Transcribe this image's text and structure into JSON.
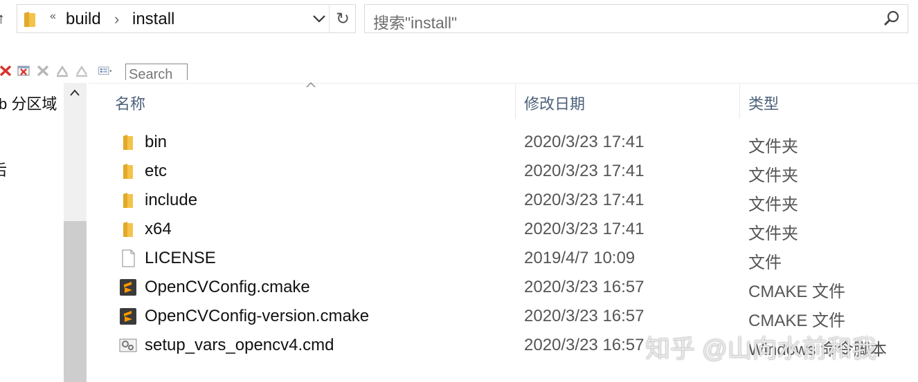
{
  "address_bar": {
    "overflow_chevron": "«",
    "crumbs": [
      "build",
      "install"
    ],
    "separator": "›"
  },
  "search": {
    "placeholder": "搜索\"install\""
  },
  "toolbar": {
    "search_fragment": "Search"
  },
  "nav": {
    "partial_labels": [
      "b 分区域",
      "后"
    ]
  },
  "columns": {
    "name": "名称",
    "modified": "修改日期",
    "type": "类型"
  },
  "files": [
    {
      "name": "bin",
      "modified": "2020/3/23 17:41",
      "type": "文件夹",
      "icon": "folder-icon"
    },
    {
      "name": "etc",
      "modified": "2020/3/23 17:41",
      "type": "文件夹",
      "icon": "folder-icon"
    },
    {
      "name": "include",
      "modified": "2020/3/23 17:41",
      "type": "文件夹",
      "icon": "folder-icon"
    },
    {
      "name": "x64",
      "modified": "2020/3/23 17:41",
      "type": "文件夹",
      "icon": "folder-icon"
    },
    {
      "name": "LICENSE",
      "modified": "2019/4/7 10:09",
      "type": "文件",
      "icon": "file-icon"
    },
    {
      "name": "OpenCVConfig.cmake",
      "modified": "2020/3/23 16:57",
      "type": "CMAKE 文件",
      "icon": "sublime-text-icon"
    },
    {
      "name": "OpenCVConfig-version.cmake",
      "modified": "2020/3/23 16:57",
      "type": "CMAKE 文件",
      "icon": "sublime-text-icon"
    },
    {
      "name": "setup_vars_opencv4.cmd",
      "modified": "2020/3/23 16:57",
      "type": "Windows 命令脚本",
      "icon": "cmd-script-icon"
    }
  ],
  "watermark": "知乎 @山向水前和我",
  "colors": {
    "folder": "#f4c34b",
    "header_text": "#4c607a",
    "sublime": "#ff9800"
  }
}
